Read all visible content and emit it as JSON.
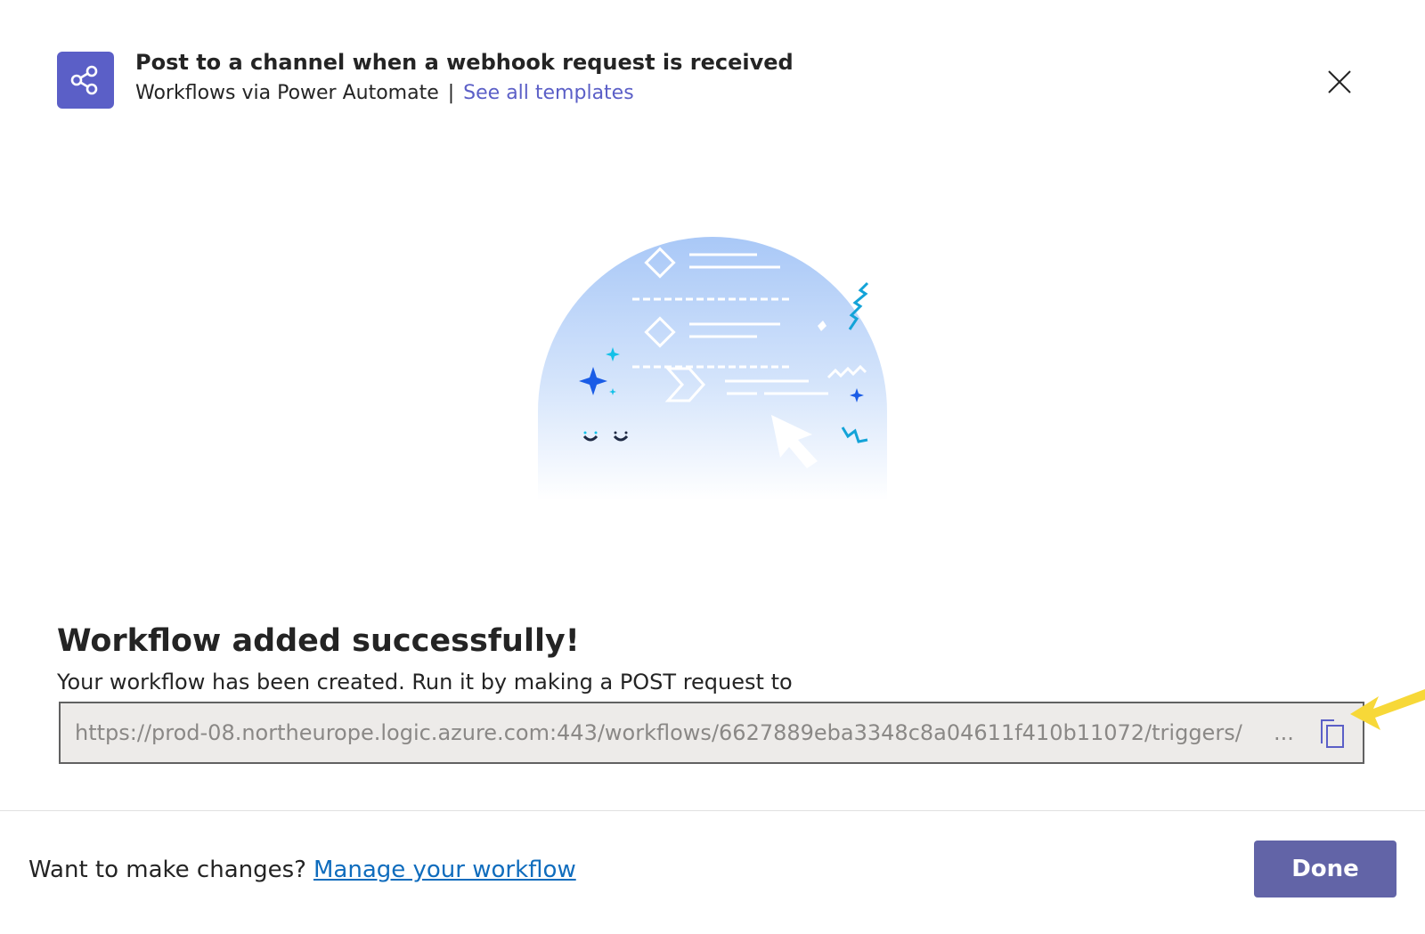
{
  "header": {
    "app_icon": "share-nodes-icon",
    "title": "Post to a channel when a webhook request is received",
    "source": "Workflows via Power Automate",
    "separator": "|",
    "templates_link": "See all templates",
    "close_icon": "close-icon"
  },
  "main": {
    "heading": "Workflow added successfully!",
    "description": "Your workflow has been created. Run it by making a POST request to",
    "url": "https://prod-08.northeurope.logic.azure.com:443/workflows/6627889eba3348c8a04611f410b11072/triggers/",
    "url_ellipsis": "...",
    "copy_icon": "copy-icon",
    "annotation_icon": "arrow-pointer-icon"
  },
  "footer": {
    "prompt": "Want to make changes?",
    "manage_link": "Manage your workflow",
    "done_label": "Done"
  },
  "colors": {
    "accent": "#5b5fc7",
    "done_button": "#6264a7",
    "link": "#0f6cbd",
    "annotation_arrow": "#f7d838"
  }
}
